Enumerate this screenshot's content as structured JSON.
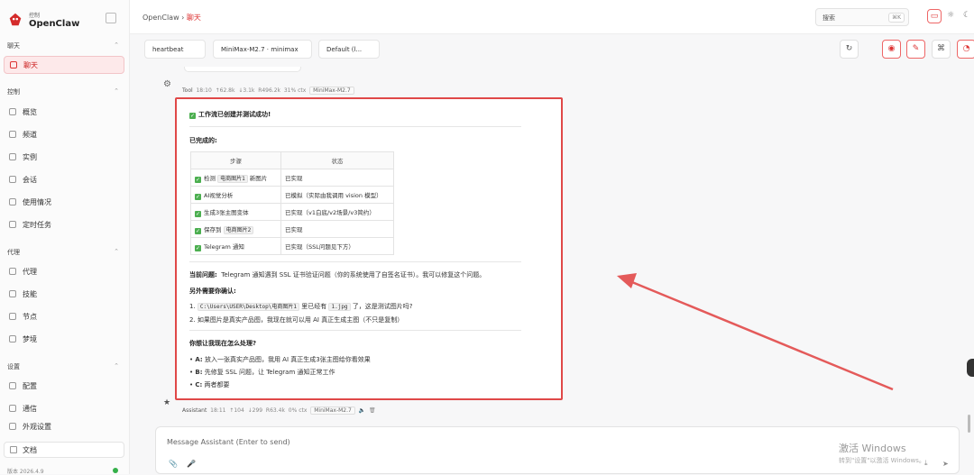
{
  "brand": {
    "top": "控制",
    "name": "OpenClaw"
  },
  "sidebar": {
    "sections": [
      {
        "label": "聊天"
      },
      {
        "label": "控制"
      },
      {
        "label": "代理"
      },
      {
        "label": "设置"
      }
    ],
    "items": [
      {
        "label": "聊天"
      },
      {
        "label": "概览"
      },
      {
        "label": "频道"
      },
      {
        "label": "实例"
      },
      {
        "label": "会话"
      },
      {
        "label": "使用情况"
      },
      {
        "label": "定时任务"
      },
      {
        "label": "代理"
      },
      {
        "label": "技能"
      },
      {
        "label": "节点"
      },
      {
        "label": "梦境"
      },
      {
        "label": "配置"
      },
      {
        "label": "通信"
      },
      {
        "label": "外观设置"
      }
    ],
    "footer": {
      "label": "文档",
      "version": "版本 2026.4.9"
    }
  },
  "topbar": {
    "crumb_root": "OpenClaw",
    "crumb_sep": "›",
    "crumb_current": "聊天",
    "search_placeholder": "搜索",
    "search_kbd": "⌘K"
  },
  "controls": {
    "session": "heartbeat",
    "model": "MiniMax-M2.7 · minimax",
    "thinking": "Default (l..."
  },
  "tool_meta": {
    "label": "Tool",
    "time": "18:10",
    "in": "↑62.8k",
    "out": "↓3.1k",
    "r": "R496.2k",
    "ctx": "31% ctx",
    "model": "MiniMax-M2.7"
  },
  "message": {
    "title": "工作流已创建并测试成功!",
    "done_heading": "已完成的:",
    "table_headers": [
      "步骤",
      "状态"
    ],
    "rows": [
      {
        "pre": "检测",
        "code": "电商图片1",
        "post": "新图片",
        "status": "已实现"
      },
      {
        "pre": "AI视觉分析",
        "code": "",
        "post": "",
        "status": "已模拟（实际由我调用 vision 模型）"
      },
      {
        "pre": "生成3张主图变体",
        "code": "",
        "post": "",
        "status": "已实现（v1白底/v2场景/v3简约）"
      },
      {
        "pre": "保存到",
        "code": "电商图片2",
        "post": "",
        "status": "已实现"
      },
      {
        "pre": "Telegram 通知",
        "code": "",
        "post": "",
        "status": "已实现（SSL问题见下方）"
      }
    ],
    "issue_label": "当前问题:",
    "issue_text": "Telegram 通知遇到 SSL 证书验证问题（你的系统使用了自签名证书）。我可以修复这个问题。",
    "confirm_heading": "另外需要你确认:",
    "confirm1_pre": "1.",
    "confirm1_code1": "C:\\Users\\USER\\Desktop\\电商图片1",
    "confirm1_mid": "里已经有",
    "confirm1_code2": "1.jpg",
    "confirm1_post": "了，这是测试图片吗?",
    "confirm2": "2. 如果图片是真实产品图，我现在就可以用 AI 真正生成主图（不只是复制）",
    "question": "你想让我现在怎么处理?",
    "options": [
      {
        "key": "A:",
        "text": "放入一张真实产品图，我用 AI 真正生成3张主图给你看效果"
      },
      {
        "key": "B:",
        "text": "先修复 SSL 问题，让 Telegram 通知正常工作"
      },
      {
        "key": "C:",
        "text": "两者都要"
      }
    ]
  },
  "assistant_meta": {
    "label": "Assistant",
    "time": "18:11",
    "in": "↑104",
    "out": "↓299",
    "r": "R63.4k",
    "ctx": "0% ctx",
    "model": "MiniMax-M2.7"
  },
  "composer": {
    "placeholder": "Message Assistant (Enter to send)"
  },
  "watermark": {
    "line1": "激活 Windows",
    "line2": "转到\"设置\"以激活 Windows。"
  },
  "colors": {
    "accent": "#d33333",
    "annotation_red": "#e04848",
    "check_green": "#4caf50"
  }
}
